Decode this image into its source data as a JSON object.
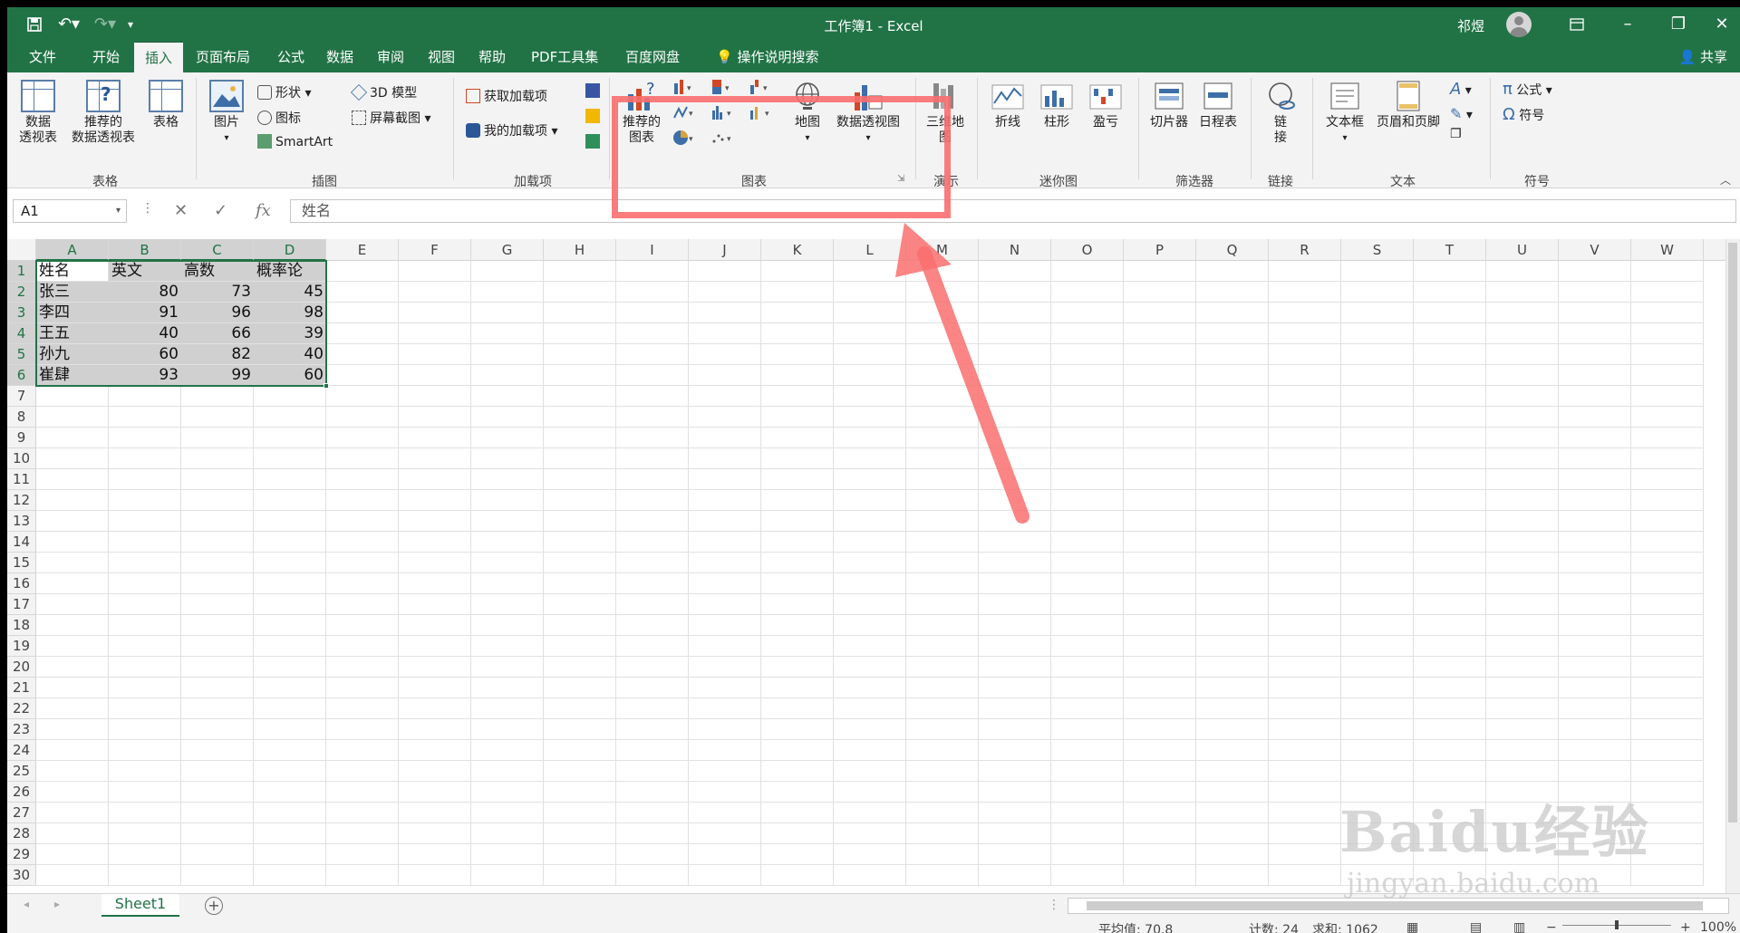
{
  "window": {
    "title": "工作簿1  -  Excel",
    "user": "祁煜"
  },
  "tabs": [
    "文件",
    "开始",
    "插入",
    "页面布局",
    "公式",
    "数据",
    "审阅",
    "视图",
    "帮助",
    "PDF工具集",
    "百度网盘",
    "操作说明搜索"
  ],
  "active_tab": "插入",
  "share_label": "共享",
  "ribbon": {
    "tables": {
      "pivot": [
        "数据",
        "透视表"
      ],
      "recommended_pivot": [
        "推荐的",
        "数据透视表"
      ],
      "table": "表格",
      "group": "表格"
    },
    "illustrations": {
      "pictures": "图片",
      "shapes": "形状",
      "icons": "图标",
      "smartart": "SmartArt",
      "model3d": "3D 模型",
      "screenshot": "屏幕截图",
      "group": "插图"
    },
    "addins": {
      "get": "获取加载项",
      "mine": "我的加载项",
      "group": "加载项"
    },
    "charts": {
      "recommended": [
        "推荐的",
        "图表"
      ],
      "maps": "地图",
      "pivotchart": "数据透视图",
      "group": "图表"
    },
    "tours": {
      "map3d": [
        "三维地",
        "图"
      ],
      "group": "演示"
    },
    "sparklines": {
      "line": "折线",
      "column": "柱形",
      "winloss": "盈亏",
      "group": "迷你图"
    },
    "filters": {
      "slicer": "切片器",
      "timeline": "日程表",
      "group": "筛选器"
    },
    "links": {
      "link": [
        "链",
        "接"
      ],
      "group": "链接"
    },
    "text": {
      "textbox": "文本框",
      "header_footer": "页眉和页脚",
      "group": "文本"
    },
    "symbols": {
      "equation": "公式",
      "symbol": "符号",
      "group": "符号"
    }
  },
  "formula_bar": {
    "name_box": "A1",
    "formula": "姓名"
  },
  "columns": [
    "A",
    "B",
    "C",
    "D",
    "E",
    "F",
    "G",
    "H",
    "I",
    "J",
    "K",
    "L",
    "M",
    "N",
    "O",
    "P",
    "Q",
    "R",
    "S",
    "T",
    "U",
    "V",
    "W"
  ],
  "rows": [
    "1",
    "2",
    "3",
    "4",
    "5",
    "6",
    "7",
    "8",
    "9",
    "10",
    "11",
    "12",
    "13",
    "14",
    "15",
    "16",
    "17",
    "18",
    "19",
    "20",
    "21",
    "22",
    "23",
    "24",
    "25",
    "26",
    "27",
    "28",
    "29",
    "30"
  ],
  "sheet": {
    "headers": [
      "姓名",
      "英文",
      "高数",
      "概率论"
    ],
    "data": [
      [
        "张三",
        "80",
        "73",
        "45"
      ],
      [
        "李四",
        "91",
        "96",
        "98"
      ],
      [
        "王五",
        "40",
        "66",
        "39"
      ],
      [
        "孙九",
        "60",
        "82",
        "40"
      ],
      [
        "崔肆",
        "93",
        "99",
        "60"
      ]
    ]
  },
  "sheet_tab": "Sheet1",
  "status": {
    "average": "平均值: 70.8",
    "count": "计数: 24",
    "sum": "求和: 1062",
    "zoom": "100%"
  },
  "watermark": {
    "brand": "Baidu经验",
    "url": "jingyan.baidu.com"
  },
  "colors": {
    "excel_green": "#217346",
    "highlight": "#fa6e6e"
  }
}
